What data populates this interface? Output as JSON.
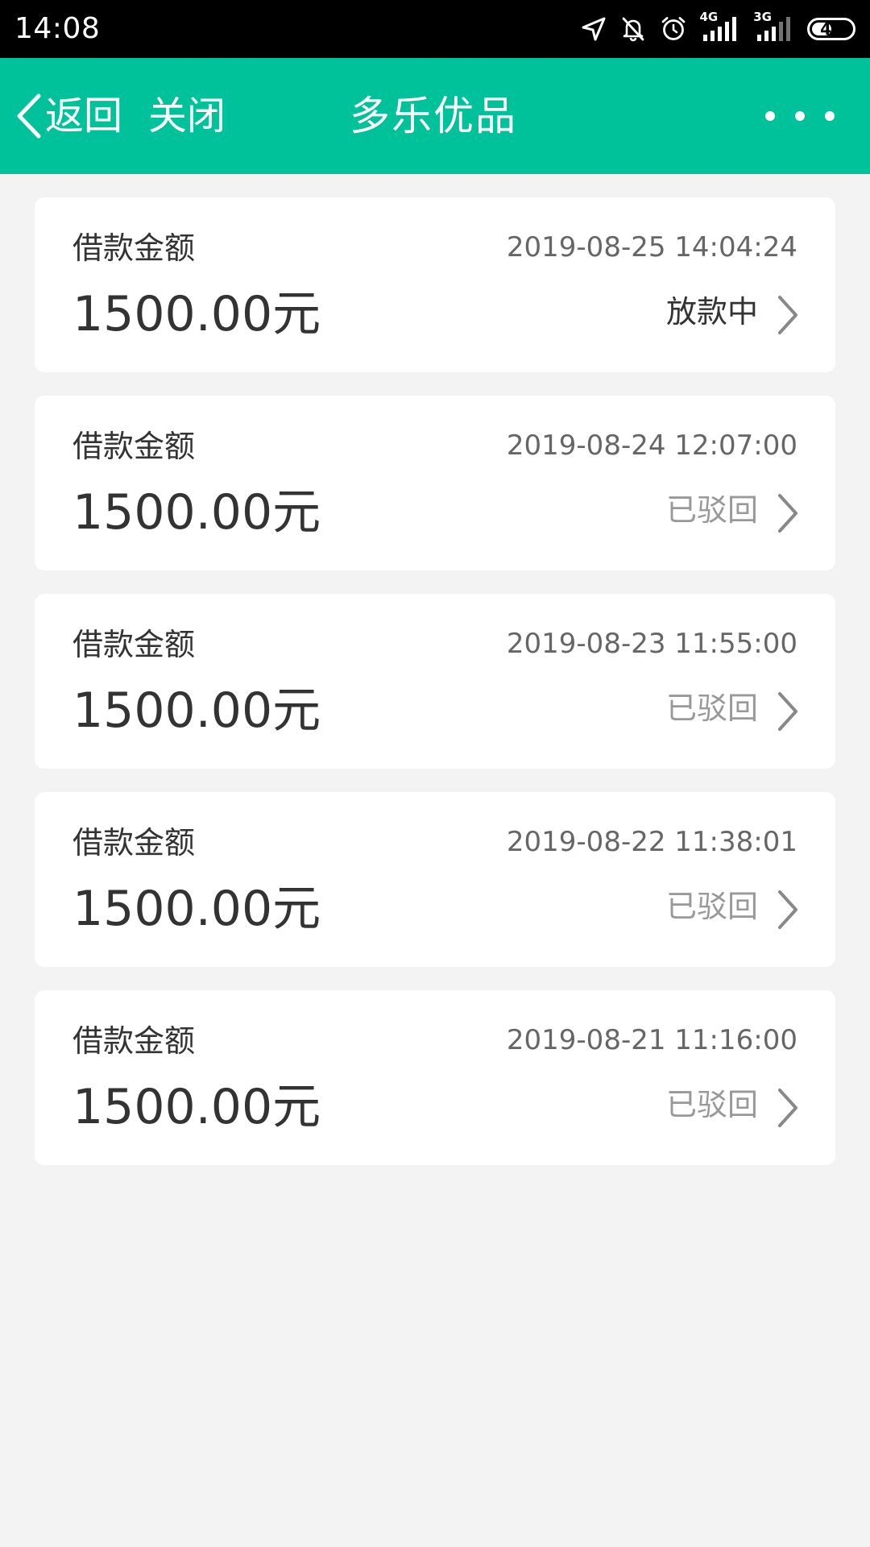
{
  "status_bar": {
    "time": "14:08",
    "net_1": "4G",
    "net_2": "3G",
    "battery": "44"
  },
  "nav": {
    "back_label": "返回",
    "close_label": "关闭",
    "title": "多乐优品"
  },
  "colors": {
    "nav_background": "#00c29a",
    "page_background": "#f3f3f3",
    "status_processing": "#333333",
    "status_rejected": "#999999"
  },
  "loans": [
    {
      "label": "借款金额",
      "date": "2019-08-25 14:04:24",
      "amount": "1500.00元",
      "status": "放款中"
    },
    {
      "label": "借款金额",
      "date": "2019-08-24 12:07:00",
      "amount": "1500.00元",
      "status": "已驳回"
    },
    {
      "label": "借款金额",
      "date": "2019-08-23 11:55:00",
      "amount": "1500.00元",
      "status": "已驳回"
    },
    {
      "label": "借款金额",
      "date": "2019-08-22 11:38:01",
      "amount": "1500.00元",
      "status": "已驳回"
    },
    {
      "label": "借款金额",
      "date": "2019-08-21 11:16:00",
      "amount": "1500.00元",
      "status": "已驳回"
    }
  ]
}
